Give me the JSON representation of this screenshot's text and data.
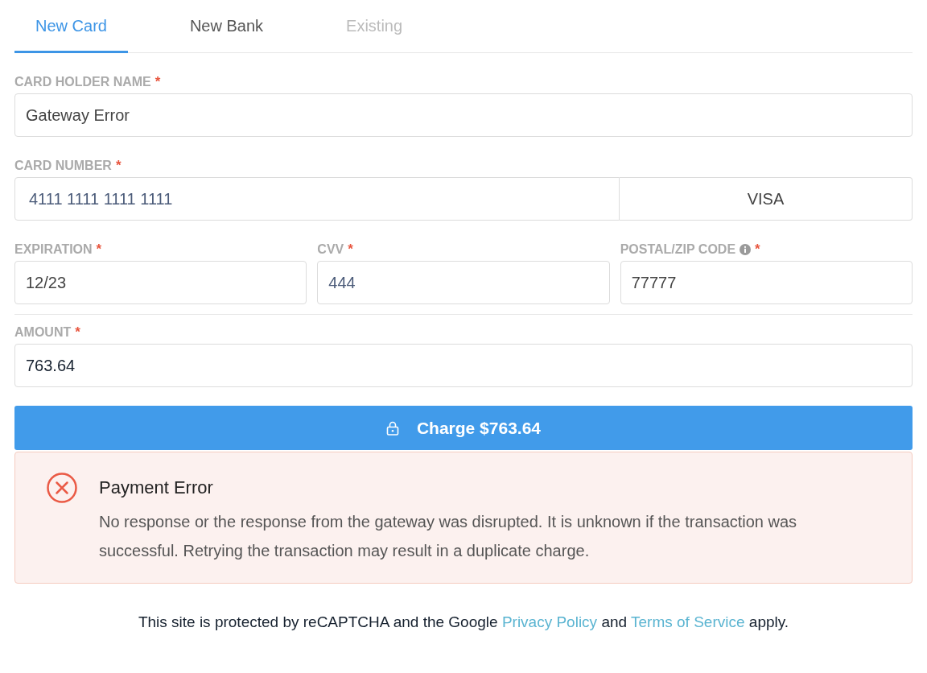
{
  "tabs": [
    {
      "label": "New Card",
      "selected": true,
      "disabled": false
    },
    {
      "label": "New Bank",
      "selected": false,
      "disabled": false
    },
    {
      "label": "Existing",
      "selected": false,
      "disabled": true
    }
  ],
  "form": {
    "rows": [
      [
        {
          "kind": "name",
          "label": "CARD HOLDER NAME",
          "required_mark": "*",
          "info_icon": false,
          "value": "Gateway Error"
        }
      ],
      [
        {
          "kind": "card_number",
          "label": "CARD NUMBER",
          "required_mark": "*",
          "info_icon": false,
          "value": "4111 1111 1111 1111",
          "brand": "VISA"
        }
      ],
      [
        {
          "kind": "expiration",
          "label": "EXPIRATION",
          "required_mark": "*",
          "info_icon": false,
          "value": "12/23"
        },
        {
          "kind": "cvv",
          "label": "CVV",
          "required_mark": "*",
          "info_icon": false,
          "value": "444"
        },
        {
          "kind": "postal",
          "label": "POSTAL/ZIP CODE",
          "required_mark": "*",
          "info_icon": true,
          "value": "77777"
        }
      ]
    ],
    "amount": {
      "kind": "amount",
      "label": "AMOUNT",
      "required_mark": "*",
      "info_icon": false,
      "value": "763.64"
    }
  },
  "submit_button": {
    "label": "Charge $763.64"
  },
  "alert": {
    "kind": "error",
    "title": "Payment Error",
    "message": "No response or the response from the gateway was disrupted. It is unknown if the transaction was successful. Retrying the transaction may result in a duplicate charge."
  },
  "footer": {
    "parts": [
      {
        "kind": "text",
        "text": "This site is protected by reCAPTCHA and the Google"
      },
      {
        "kind": "link",
        "text": "Privacy Policy"
      },
      {
        "kind": "text",
        "text": "and"
      },
      {
        "kind": "link",
        "text": "Terms of Service"
      },
      {
        "kind": "text",
        "text": "apply."
      }
    ]
  }
}
